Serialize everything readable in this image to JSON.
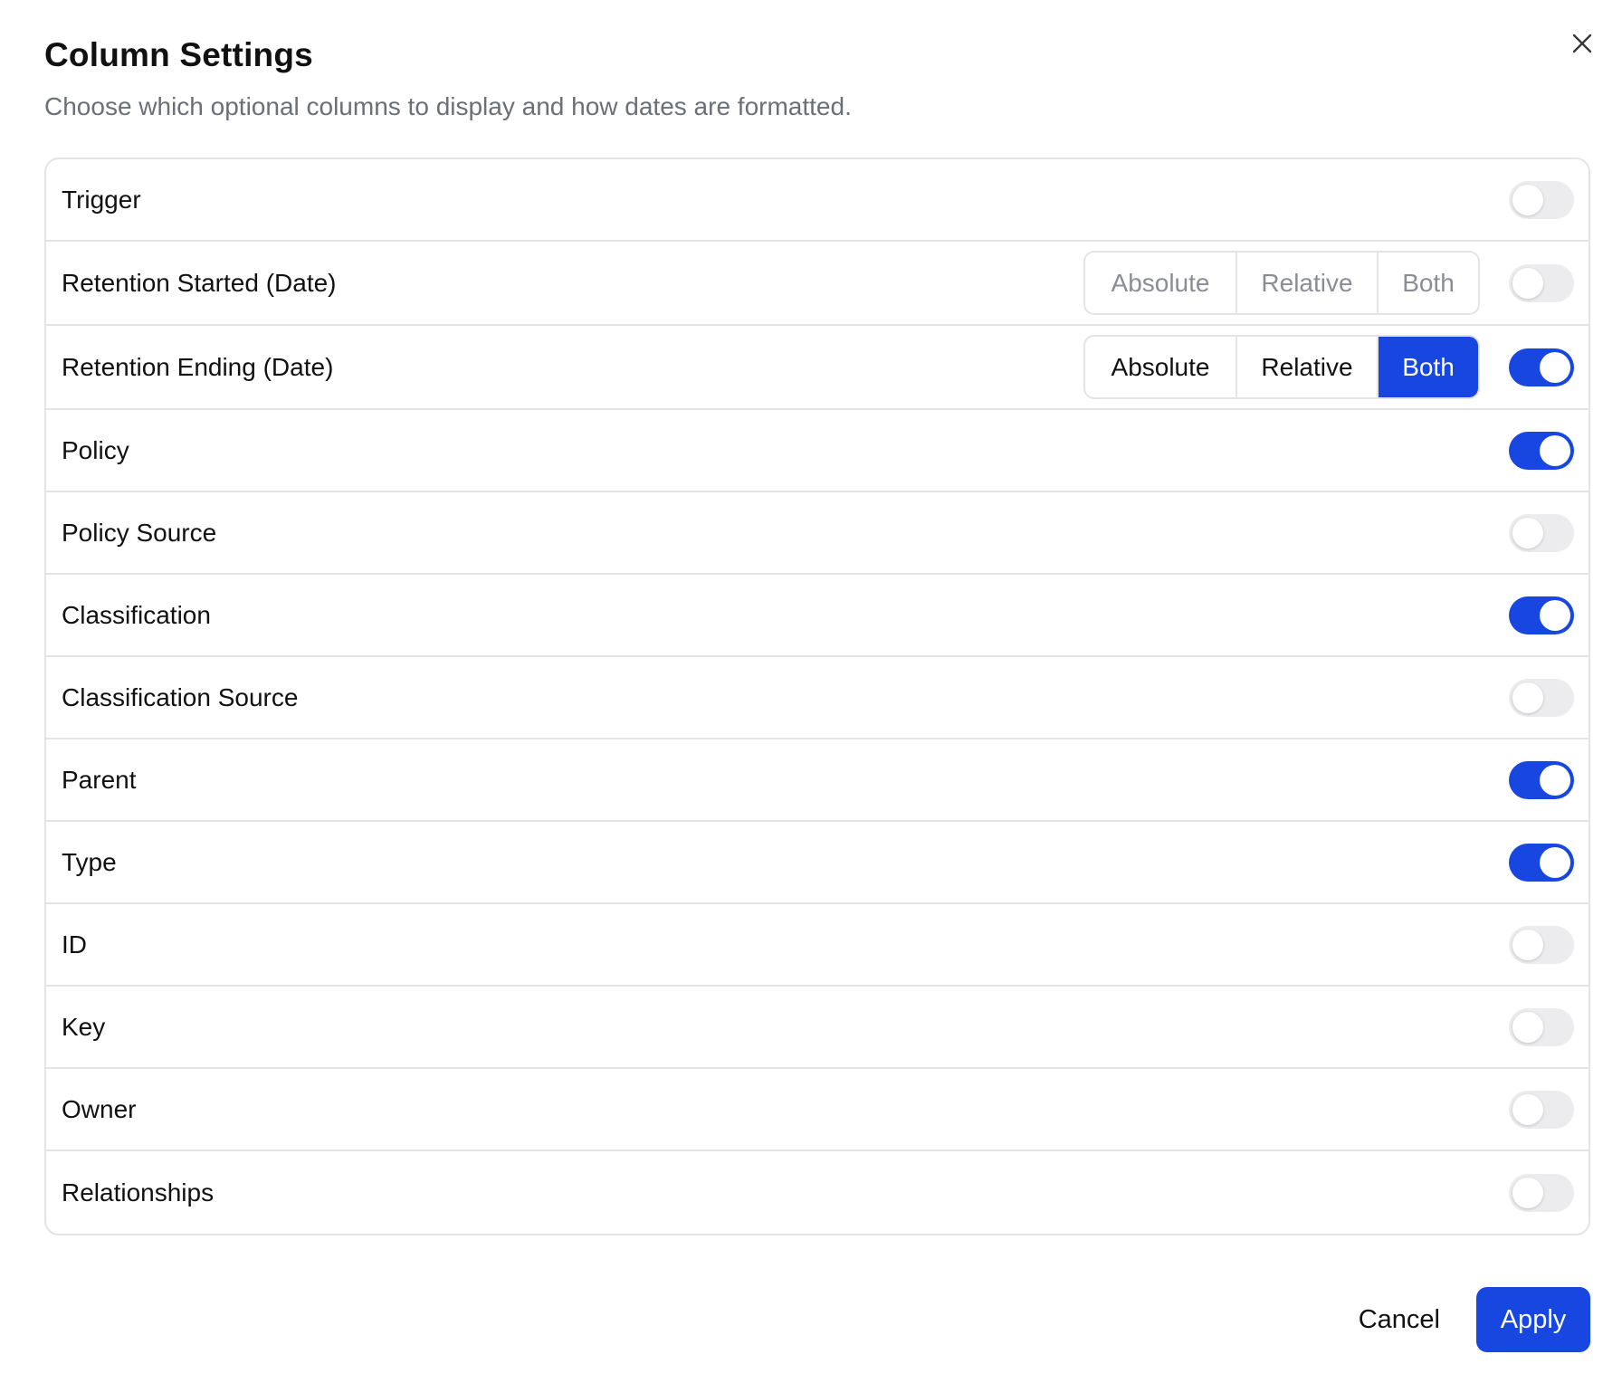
{
  "dialog": {
    "title": "Column Settings",
    "subtitle": "Choose which optional columns to display and how dates are formatted.",
    "close_icon": "close-icon"
  },
  "rows": [
    {
      "label": "Trigger",
      "enabled": false
    },
    {
      "label": "Retention Started (Date)",
      "enabled": false,
      "format": {
        "options": [
          "Absolute",
          "Relative",
          "Both"
        ],
        "selected": "Both"
      }
    },
    {
      "label": "Retention Ending (Date)",
      "enabled": true,
      "format": {
        "options": [
          "Absolute",
          "Relative",
          "Both"
        ],
        "selected": "Both"
      }
    },
    {
      "label": "Policy",
      "enabled": true
    },
    {
      "label": "Policy Source",
      "enabled": false
    },
    {
      "label": "Classification",
      "enabled": true
    },
    {
      "label": "Classification Source",
      "enabled": false
    },
    {
      "label": "Parent",
      "enabled": true
    },
    {
      "label": "Type",
      "enabled": true
    },
    {
      "label": "ID",
      "enabled": false
    },
    {
      "label": "Key",
      "enabled": false
    },
    {
      "label": "Owner",
      "enabled": false
    },
    {
      "label": "Relationships",
      "enabled": false
    }
  ],
  "footer": {
    "cancel_label": "Cancel",
    "apply_label": "Apply"
  },
  "colors": {
    "accent": "#1746e0",
    "border": "#e4e4e7",
    "toggle_off": "#ececee",
    "muted_text": "#6b6f76"
  }
}
